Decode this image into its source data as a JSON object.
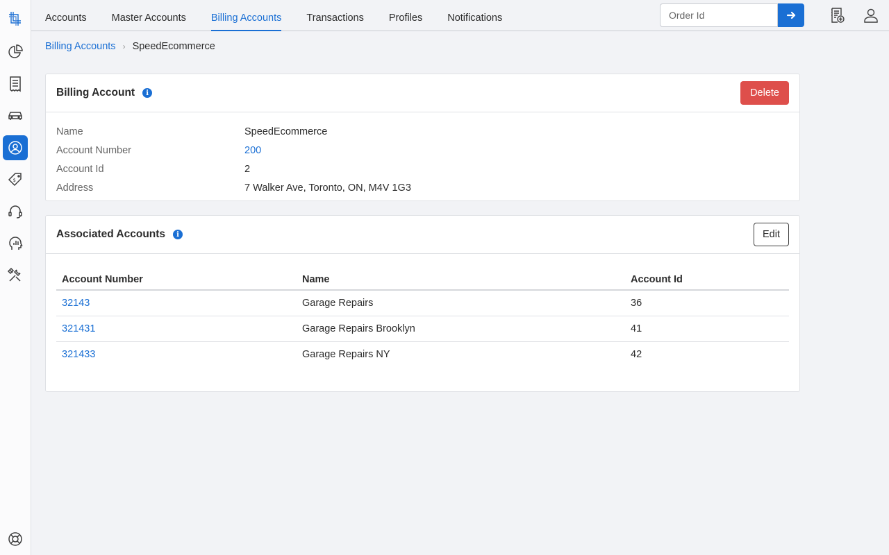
{
  "nav": {
    "tabs": [
      {
        "label": "Accounts"
      },
      {
        "label": "Master Accounts"
      },
      {
        "label": "Billing Accounts",
        "active": true
      },
      {
        "label": "Transactions"
      },
      {
        "label": "Profiles"
      },
      {
        "label": "Notifications"
      }
    ],
    "search": {
      "placeholder": "Order Id",
      "value": ""
    }
  },
  "breadcrumb": {
    "parent": "Billing Accounts",
    "current": "SpeedEcommerce"
  },
  "billing_account": {
    "title": "Billing Account",
    "delete_label": "Delete",
    "fields": [
      {
        "label": "Name",
        "value": "SpeedEcommerce"
      },
      {
        "label": "Account Number",
        "value": "200"
      },
      {
        "label": "Account Id",
        "value": "2"
      },
      {
        "label": "Address",
        "value": "7 Walker Ave, Toronto, ON, M4V 1G3"
      }
    ]
  },
  "associated_accounts": {
    "title": "Associated Accounts",
    "edit_label": "Edit",
    "columns": [
      "Account Number",
      "Name",
      "Account Id"
    ],
    "rows": [
      {
        "account_number": "32143",
        "name": "Garage Repairs",
        "account_id": "36"
      },
      {
        "account_number": "321431",
        "name": "Garage Repairs Brooklyn",
        "account_id": "41"
      },
      {
        "account_number": "321433",
        "name": "Garage Repairs NY",
        "account_id": "42"
      }
    ]
  },
  "colors": {
    "accent": "#1a6fd4",
    "danger": "#de4f4b"
  }
}
